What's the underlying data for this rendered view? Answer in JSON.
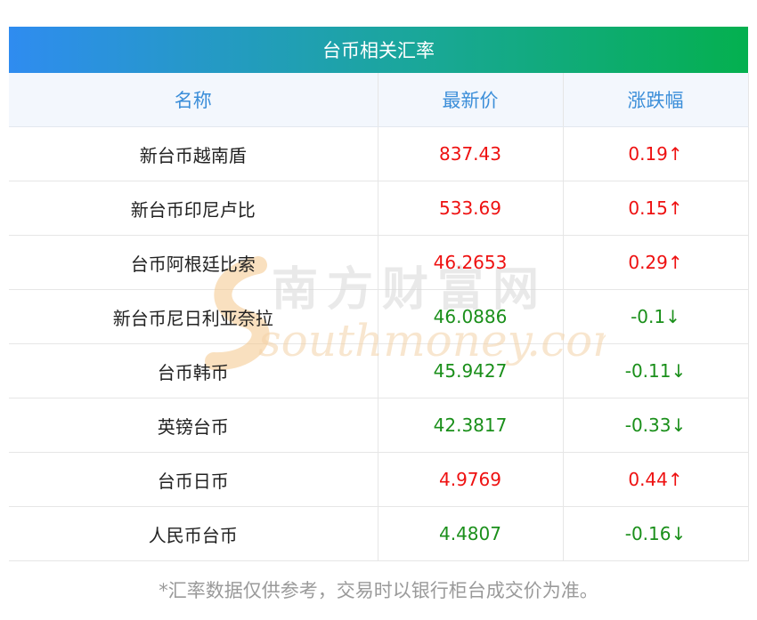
{
  "title": "台币相关汇率",
  "table": {
    "headers": [
      "名称",
      "最新价",
      "涨跌幅"
    ],
    "rows": [
      {
        "name": "新台币越南盾",
        "price": "837.43",
        "change": "0.19",
        "direction": "up"
      },
      {
        "name": "新台币印尼卢比",
        "price": "533.69",
        "change": "0.15",
        "direction": "up"
      },
      {
        "name": "台币阿根廷比索",
        "price": "46.2653",
        "change": "0.29",
        "direction": "up"
      },
      {
        "name": "新台币尼日利亚奈拉",
        "price": "46.0886",
        "change": "-0.1",
        "direction": "down"
      },
      {
        "name": "台币韩币",
        "price": "45.9427",
        "change": "-0.11",
        "direction": "down"
      },
      {
        "name": "英镑台币",
        "price": "42.3817",
        "change": "-0.33",
        "direction": "down"
      },
      {
        "name": "台币日币",
        "price": "4.9769",
        "change": "0.44",
        "direction": "up"
      },
      {
        "name": "人民币台币",
        "price": "4.4807",
        "change": "-0.16",
        "direction": "down"
      }
    ]
  },
  "arrows": {
    "up": "↑",
    "down": "↓"
  },
  "watermark": {
    "cn": "南方财富网",
    "en": "southmoney.com",
    "icon": "southmoney-logo-icon"
  },
  "colors": {
    "up": "#ee1111",
    "down": "#1a8f1a",
    "header_text": "#3b8ed9",
    "title_start": "#2f8cf0",
    "title_end": "#04b04f"
  },
  "footnote": "*汇率数据仅供参考，交易时以银行柜台成交价为准。"
}
